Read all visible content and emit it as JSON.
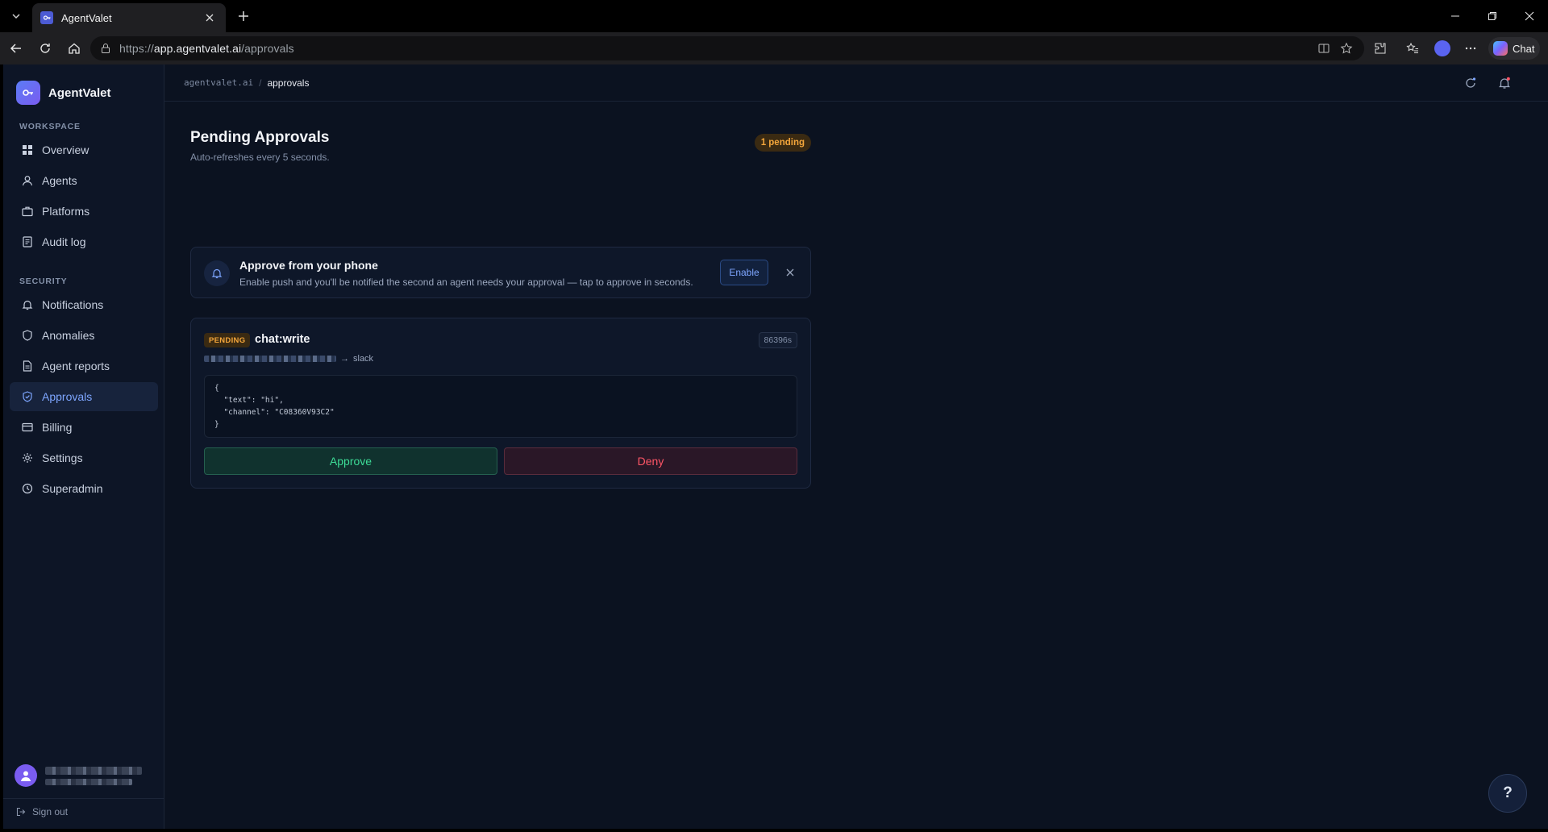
{
  "browser": {
    "tab_title": "AgentValet",
    "url_prefix": "https://",
    "url_host": "app.agentvalet.ai",
    "url_path": "/approvals",
    "chat_label": "Chat"
  },
  "sidebar": {
    "brand": "AgentValet",
    "workspace_label": "WORKSPACE",
    "workspace_items": [
      {
        "label": "Overview",
        "icon": "grid-icon"
      },
      {
        "label": "Agents",
        "icon": "user-icon"
      },
      {
        "label": "Platforms",
        "icon": "briefcase-icon"
      },
      {
        "label": "Audit log",
        "icon": "document-icon"
      }
    ],
    "security_label": "SECURITY",
    "security_items": [
      {
        "label": "Notifications",
        "icon": "bell-icon"
      },
      {
        "label": "Anomalies",
        "icon": "shield-icon"
      },
      {
        "label": "Agent reports",
        "icon": "document-icon"
      },
      {
        "label": "Approvals",
        "icon": "shield-check-icon",
        "active": true
      },
      {
        "label": "Billing",
        "icon": "card-icon"
      },
      {
        "label": "Settings",
        "icon": "gear-icon"
      },
      {
        "label": "Superadmin",
        "icon": "clock-icon"
      }
    ],
    "sign_out": "Sign out"
  },
  "breadcrumb": {
    "root": "agentvalet.ai",
    "separator": "/",
    "current": "approvals"
  },
  "page": {
    "title": "Pending Approvals",
    "subtitle": "Auto-refreshes every 5 seconds.",
    "pending_badge": "1 pending"
  },
  "push_prompt": {
    "title": "Approve from your phone",
    "description": "Enable push and you'll be notified the second an agent needs your approval — tap to approve in seconds.",
    "enable_label": "Enable"
  },
  "approval": {
    "status": "PENDING",
    "scope": "chat:write",
    "ttl": "86396s",
    "route_arrow": "→",
    "platform": "slack",
    "payload": "{\n  \"text\": \"hi\",\n  \"channel\": \"C08360V93C2\"\n}",
    "approve_label": "Approve",
    "deny_label": "Deny"
  },
  "help_label": "?",
  "colors": {
    "background": "#0b1220",
    "sidebar": "#0d1526",
    "accent": "#7ea6ff",
    "pending": "#f4a63b",
    "approve": "#3ddc97",
    "deny": "#ff5566"
  }
}
